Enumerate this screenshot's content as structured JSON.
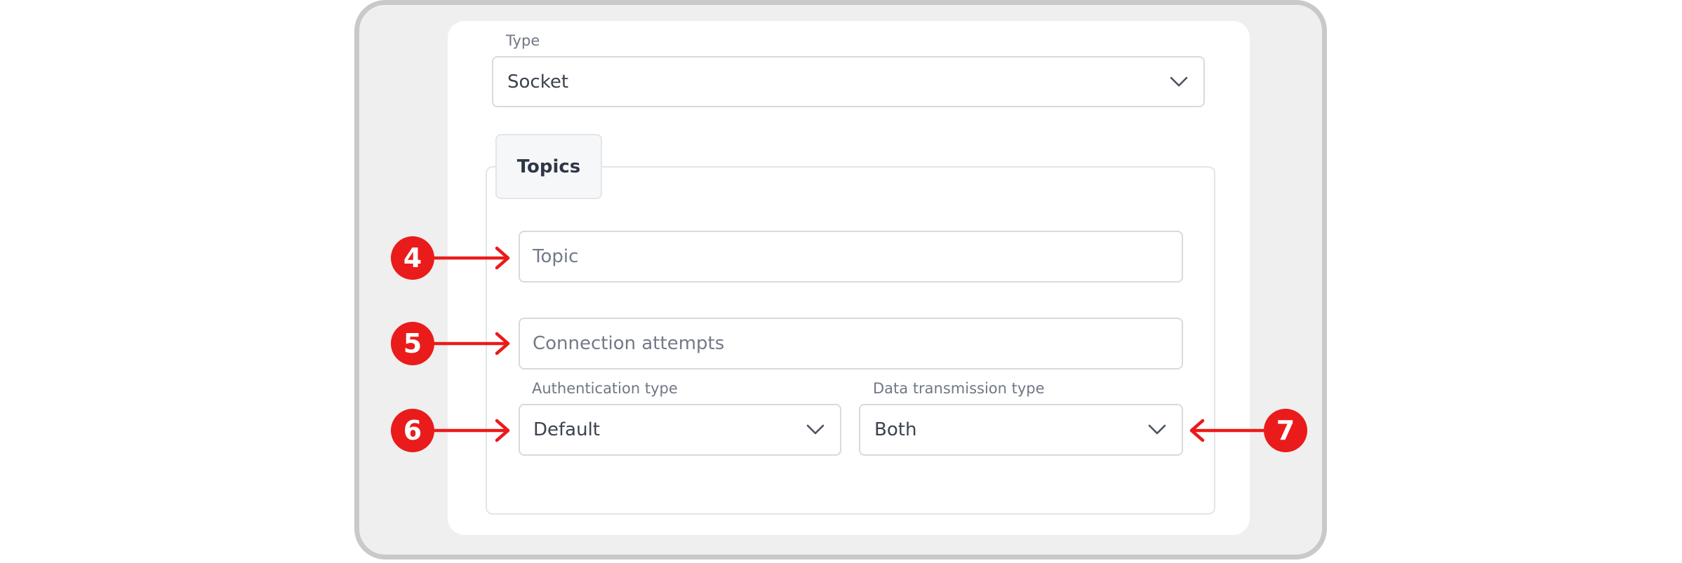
{
  "form": {
    "type_label": "Type",
    "type_value": "Socket",
    "topics_tab": "Topics",
    "topic_placeholder": "Topic",
    "connection_attempts_placeholder": "Connection attempts",
    "auth_label": "Authentication type",
    "auth_value": "Default",
    "transmission_label": "Data transmission type",
    "transmission_value": "Both"
  },
  "callouts": {
    "topic": "4",
    "connection_attempts": "5",
    "auth_type": "6",
    "transmission_type": "7"
  },
  "icons": {
    "dropdown": "chevron-down-icon",
    "pointer": "arrow-icon"
  },
  "colors": {
    "callout": "#ea1b1b",
    "border": "#d7dadf",
    "frame": "#c9c9c9"
  }
}
